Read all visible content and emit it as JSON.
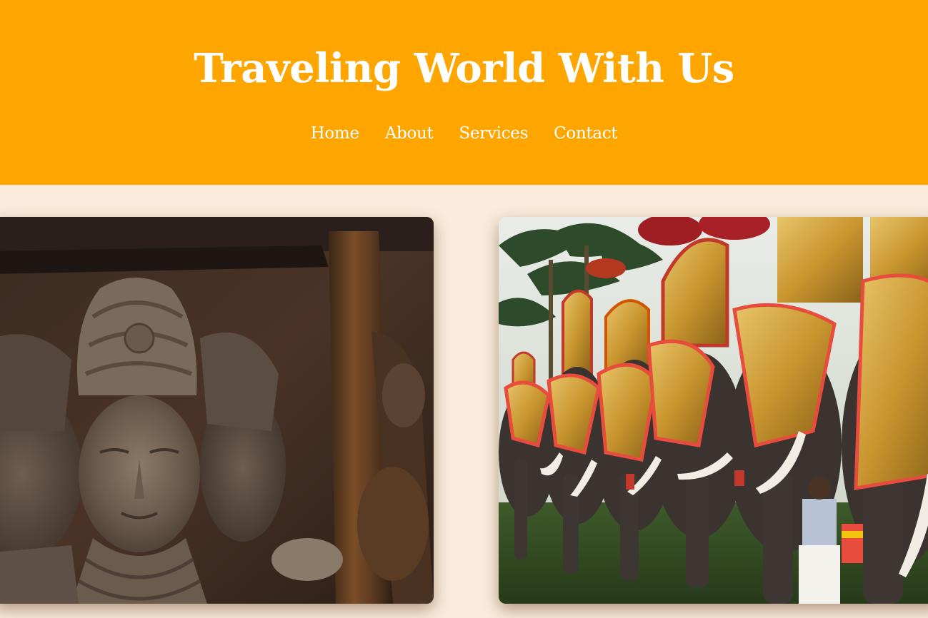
{
  "header": {
    "title": "Traveling World With Us",
    "background_color": "#ffa500",
    "text_color": "#ffffff"
  },
  "nav": {
    "items": [
      {
        "label": "Home"
      },
      {
        "label": "About"
      },
      {
        "label": "Services"
      },
      {
        "label": "Contact"
      }
    ]
  },
  "page": {
    "background_color": "#faebdc"
  },
  "gallery": {
    "images": [
      {
        "subject": "carved stone deity sculpture in a cave"
      },
      {
        "subject": "row of caparisoned elephants at a festival"
      }
    ]
  }
}
